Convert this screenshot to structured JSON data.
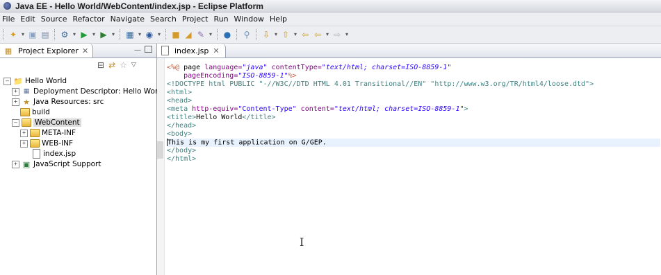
{
  "window": {
    "title": "Java EE - Hello World/WebContent/index.jsp - Eclipse Platform"
  },
  "menu": [
    "File",
    "Edit",
    "Source",
    "Refactor",
    "Navigate",
    "Search",
    "Project",
    "Run",
    "Window",
    "Help"
  ],
  "project_explorer": {
    "tab_label": "Project Explorer",
    "tree": [
      {
        "label": "Hello World",
        "icon": "project-icon"
      },
      {
        "label": "Deployment Descriptor: Hello World",
        "icon": "deployment-descriptor-icon"
      },
      {
        "label": "Java Resources: src",
        "icon": "java-resources-icon"
      },
      {
        "label": "build",
        "icon": "folder-icon"
      },
      {
        "label": "WebContent",
        "icon": "folder-icon",
        "selected": true
      },
      {
        "label": "META-INF",
        "icon": "folder-icon"
      },
      {
        "label": "WEB-INF",
        "icon": "folder-icon"
      },
      {
        "label": "index.jsp",
        "icon": "file-icon"
      },
      {
        "label": "JavaScript Support",
        "icon": "javascript-support-icon"
      }
    ]
  },
  "editor": {
    "tab_label": "index.jsp",
    "lines": [
      "<%@ page language=\"java\" contentType=\"text/html; charset=ISO-8859-1\"",
      "    pageEncoding=\"ISO-8859-1\"%>",
      "<!DOCTYPE html PUBLIC \"-//W3C//DTD HTML 4.01 Transitional//EN\" \"http://www.w3.org/TR/html4/loose.dtd\">",
      "<html>",
      "<head>",
      "<meta http-equiv=\"Content-Type\" content=\"text/html; charset=ISO-8859-1\">",
      "<title>Hello World</title>",
      "</head>",
      "<body>",
      "This is my first application on G/GEP.",
      "</body>",
      "</html>"
    ]
  },
  "colors": {
    "tag": "#3f7f7f",
    "attribute": "#7f007f",
    "value": "#2a00ff",
    "jsp_delimiter": "#bf5f3f",
    "current_line": "#e8f2fe"
  }
}
